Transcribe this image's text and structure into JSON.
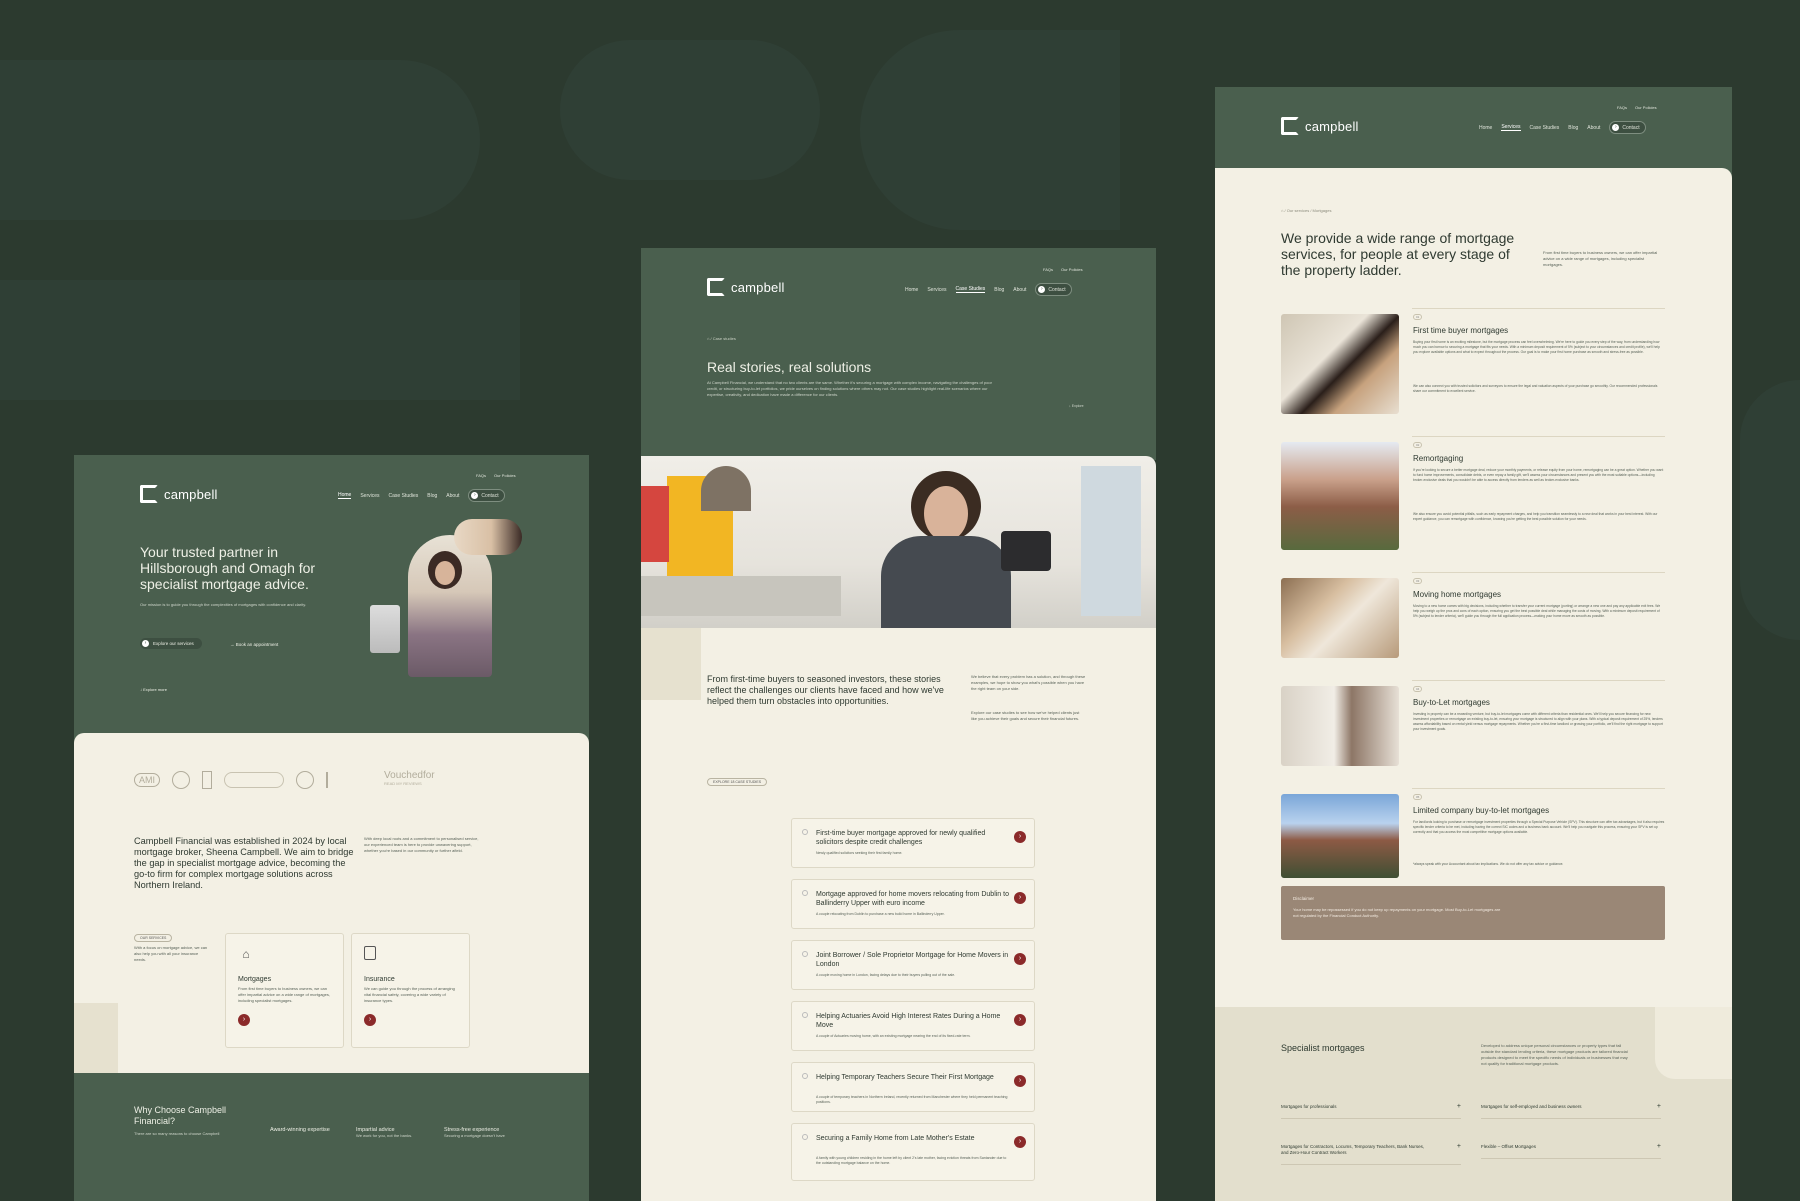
{
  "brand": {
    "name": "campbell"
  },
  "home": {
    "toplinks": [
      "FAQs",
      "Our Policies"
    ],
    "nav": [
      "Home",
      "Services",
      "Case Studies",
      "Blog",
      "About"
    ],
    "contact": "Contact",
    "hero_title": "Your trusted partner in Hillsborough and Omagh for specialist mortgage advice.",
    "hero_text": "Our mission is to guide you through the complexities of mortgages with confidence and clarity.",
    "cta_primary": "Explore our services",
    "cta_secondary": "Book an appointment",
    "explore": "Explore more",
    "logos": [
      "AMI",
      "Vouchedfor",
      "READ MY REVIEWS"
    ],
    "about_title": "Campbell Financial was established in 2024 by local mortgage broker, Sheena Campbell. We aim to bridge the gap in specialist mortgage advice, becoming the go-to firm for complex mortgage solutions across Northern Ireland.",
    "about_text": "With deep local roots and a commitment to personalised service, our experienced team is here to provide unwavering support, whether you're based in our community or further afield.",
    "services_badge": "OUR SERVICES",
    "services_text": "With a focus on mortgage advice, we can also help you with all your insurance needs.",
    "cards": [
      {
        "title": "Mortgages",
        "text": "From first time buyers to business owners, we can offer impartial advice on a wide range of mortgages, including specialist mortgages."
      },
      {
        "title": "Insurance",
        "text": "We can guide you through the process of arranging vital financial safety, covering a wide variety of insurance types."
      }
    ],
    "why_title": "Why Choose Campbell Financial?",
    "why_text": "There are so many reasons to choose Campbell",
    "why_items": [
      {
        "title": "Award-winning expertise",
        "text": ""
      },
      {
        "title": "Impartial advice",
        "text": "We work for you, not the banks."
      },
      {
        "title": "Stress-free experience",
        "text": "Securing a mortgage doesn't have"
      }
    ]
  },
  "cases": {
    "toplinks": [
      "FAQs",
      "Our Policies"
    ],
    "nav": [
      "Home",
      "Services",
      "Case Studies",
      "Blog",
      "About"
    ],
    "contact": "Contact",
    "crumb": "Case studies",
    "title": "Real stories, real solutions",
    "text": "At Campbell Financial, we understand that no two clients are the same. Whether it's securing a mortgage with complex income, navigating the challenges of poor credit, or structuring buy-to-let portfolios, we pride ourselves on finding solutions where others may not. Our case studies highlight real-life scenarios where our expertise, creativity, and dedication have made a difference for our clients.",
    "explore": "Explore",
    "intro": "From first-time buyers to seasoned investors, these stories reflect the challenges our clients have faced and how we've helped them turn obstacles into opportunities.",
    "side1": "We believe that every problem has a solution, and through these examples, we hope to show you what's possible when you have the right team on your side.",
    "side2": "Explore our case studies to see how we've helped clients just like you achieve their goals and secure their financial futures.",
    "badge": "EXPLORE 18 CASE STUDIES",
    "items": [
      {
        "title": "First-time buyer mortgage approved for newly qualified solicitors despite credit challenges",
        "text": "Newly qualified solicitors seeking their first family home."
      },
      {
        "title": "Mortgage approved for home movers relocating from Dublin to Ballinderry Upper with euro income",
        "text": "A couple relocating from Dublin to purchase a new build home in Ballinderry Upper."
      },
      {
        "title": "Joint Borrower / Sole Proprietor Mortgage for Home Movers in London",
        "text": "A couple moving home in London, facing delays due to their buyers pulling out of the sale."
      },
      {
        "title": "Helping Actuaries Avoid High Interest Rates During a Home Move",
        "text": "A couple of Actuaries moving home, with an existing mortgage nearing the end of its fixed-rate term."
      },
      {
        "title": "Helping Temporary Teachers Secure Their First Mortgage",
        "text": "A couple of temporary teachers in Northern Ireland, recently returned from Manchester where they held permanent teaching positions."
      },
      {
        "title": "Securing a Family Home from Late Mother's Estate",
        "text": "A family with young children residing in the home left by client 2's late mother, facing eviction threats from Santander due to the outstanding mortgage balance on the home."
      }
    ]
  },
  "mortgages": {
    "toplinks": [
      "FAQs",
      "Our Policies"
    ],
    "nav": [
      "Home",
      "Services",
      "Case Studies",
      "Blog",
      "About"
    ],
    "contact": "Contact",
    "crumb": "Our services / Mortgages",
    "title": "We provide a wide range of mortgage services, for people at every stage of the property ladder.",
    "side": "From first time buyers to business owners, we can offer impartial advice on a wide range of mortgages, including specialist mortgages.",
    "items": [
      {
        "num": "01",
        "title": "First time buyer mortgages",
        "text": "Buying your first home is an exciting milestone, but the mortgage process can feel overwhelming. We're here to guide you every step of the way, from understanding how much you can borrow to securing a mortgage that fits your needs. With a minimum deposit requirement of 5% (subject to your circumstances and credit profile), we'll help you explore available options and what to expect throughout the process. Our goal is to make your first home purchase as smooth and stress-free as possible.",
        "text2": "We can also connect you with trusted solicitors and surveyors to ensure the legal and valuation aspects of your purchase go smoothly. Our recommended professionals share our commitment to excellent service."
      },
      {
        "num": "02",
        "title": "Remortgaging",
        "text": "If you're looking to secure a better mortgage deal, reduce your monthly payments, or release equity from your home, remortgaging can be a great option. Whether you want to fund home improvements, consolidate debts, or even repay a family gift, we'll assess your circumstances and present you with the most suitable options—including broker-exclusive deals that you wouldn't be able to access directly from lenders as well as broker-exclusive banks.",
        "text2": "We also ensure you avoid potential pitfalls, such as early repayment charges, and help you transition seamlessly to a new deal that works in your best interest. With our expert guidance, you can remortgage with confidence, knowing you're getting the best possible solution for your needs."
      },
      {
        "num": "03",
        "title": "Moving home mortgages",
        "text": "Moving to a new home comes with big decisions, including whether to transfer your current mortgage (porting) or arrange a new one and pay any applicable exit fees. We help you weigh up the pros and cons of each option, ensuring you get the best possible deal while managing the costs of moving. With a minimum deposit requirement of 5% (subject to lender criteria), we'll guide you through the full application process—making your home move as smooth as possible.",
        "text2": ""
      },
      {
        "num": "04",
        "title": "Buy-to-Let mortgages",
        "text": "Investing in property can be a rewarding venture, but buy-to-let mortgages come with different criteria than residential ones. We'll help you secure financing for new investment properties or remortgage an existing buy-to-let, ensuring your mortgage is structured to align with your plans. With a typical deposit requirement of 25%, lenders assess affordability based on rental yield versus mortgage repayments. Whether you're a first-time landlord or growing your portfolio, we'll find the right mortgage to support your investment goals.",
        "text2": ""
      },
      {
        "num": "05",
        "title": "Limited company buy-to-let mortgages",
        "text": "For landlords looking to purchase or remortgage investment properties through a Special Purpose Vehicle (SPV). This structure can offer tax advantages, but it also requires specific lender criteria to be met, including having the correct SIC codes and a business bank account. We'll help you navigate this process, ensuring your SPV is set up correctly and that you access the most competitive mortgage options available.",
        "text2": "*always speak with your Accountant about tax implications. We do not offer any tax advice or guidance."
      }
    ],
    "disclaimer_title": "Disclaimer",
    "disclaimer_text": "Your home may be repossessed if you do not keep up repayments on your mortgage. Most Buy-to-Let mortgages are not regulated by the Financial Conduct Authority.",
    "specialist_title": "Specialist mortgages",
    "specialist_text": "Developed to address unique personal circumstances or property types that fall outside the standard lending criteria, these mortgage products are tailored financial products designed to meet the specific needs of individuals or businesses that may not qualify for traditional mortgage products.",
    "accordion": [
      "Mortgages for professionals",
      "Mortgages for self-employed and business owners",
      "Mortgages for Contractors, Locums, Temporary Teachers, Bank Nurses, and Zero-Hour Contract Workers",
      "Flexible – Offset Mortgages"
    ]
  },
  "icons": [
    "house-percent-icon",
    "lock-icon",
    "arrow-right-icon",
    "plus-icon",
    "home-icon",
    "chevron-down-icon"
  ],
  "colors": {
    "bg": "#2c3a2f",
    "green": "#4a5f4e",
    "cream": "#f3f0e4",
    "accent": "#8b2a2a",
    "disclaimer": "#9a8776"
  }
}
